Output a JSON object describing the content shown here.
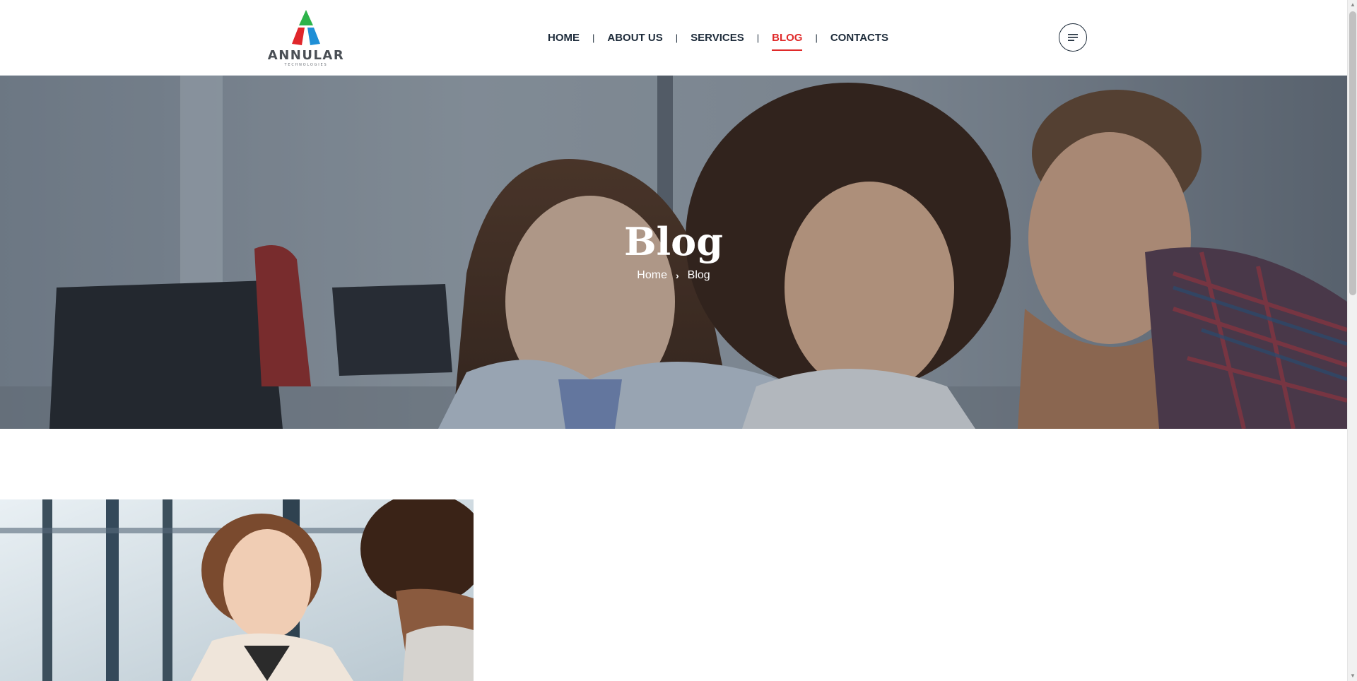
{
  "header": {
    "logo": {
      "wordmark": "ANNULAR",
      "tagline": "TECHNOLOGIES"
    },
    "nav": [
      {
        "label": "HOME",
        "active": false
      },
      {
        "label": "ABOUT US",
        "active": false
      },
      {
        "label": "SERVICES",
        "active": false
      },
      {
        "label": "BLOG",
        "active": true
      },
      {
        "label": "CONTACTS",
        "active": false
      }
    ],
    "nav_separator": "|",
    "menu_icon": "menu-lines-icon"
  },
  "hero": {
    "title": "Blog",
    "breadcrumb": {
      "home": "Home",
      "separator_icon": "chevron-right-icon",
      "current": "Blog"
    },
    "image_description_icon": "team-photo"
  },
  "colors": {
    "accent": "#e02a2a",
    "nav_text": "#1d2b3a",
    "logo_green": "#2db34a",
    "logo_red": "#e0262b",
    "logo_blue": "#1f8fd6"
  }
}
